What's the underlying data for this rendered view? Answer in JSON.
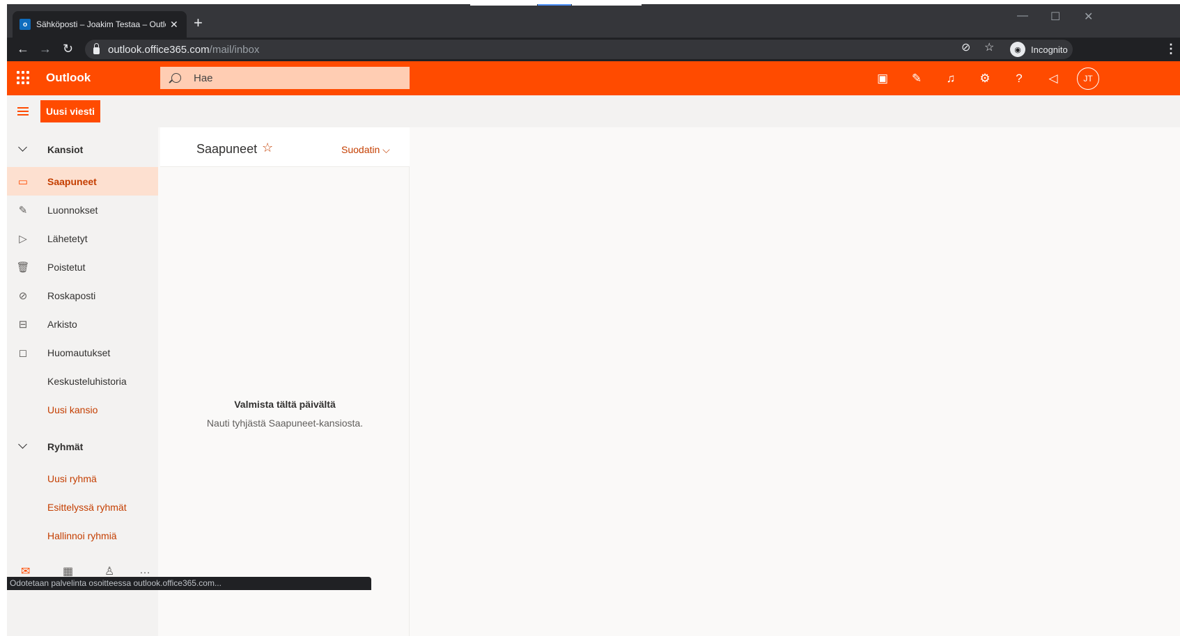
{
  "browser": {
    "tab_title": "Sähköposti – Joakim Testaa – Outlook",
    "tab_favicon": "o",
    "url_host": "outlook.office365.com",
    "url_path": "/mail/inbox",
    "incognito_label": "Incognito",
    "status_text": "Odotetaan palvelinta osoitteessa outlook.office365.com..."
  },
  "header": {
    "app_name": "Outlook",
    "search_placeholder": "Hae",
    "avatar_initials": "JT",
    "brand_color": "#ff4b00",
    "icons": [
      "office-icon",
      "todo-icon",
      "bell-icon",
      "gear-icon",
      "help-icon",
      "megaphone-icon"
    ]
  },
  "toolbar": {
    "new_message_label": "Uusi viesti"
  },
  "nav": {
    "folders_label": "Kansiot",
    "items": [
      {
        "label": "Saapuneet",
        "icon": "inbox-icon",
        "active": true
      },
      {
        "label": "Luonnokset",
        "icon": "pencil-icon"
      },
      {
        "label": "Lähetetyt",
        "icon": "send-icon"
      },
      {
        "label": "Poistetut",
        "icon": "trash-icon"
      },
      {
        "label": "Roskaposti",
        "icon": "blocked-icon"
      },
      {
        "label": "Arkisto",
        "icon": "archive-icon"
      },
      {
        "label": "Huomautukset",
        "icon": "note-icon"
      },
      {
        "label": "Keskusteluhistoria"
      }
    ],
    "new_folder_label": "Uusi kansio",
    "groups_label": "Ryhmät",
    "group_links": [
      {
        "label": "Uusi ryhmä"
      },
      {
        "label": "Esittelyssä ryhmät"
      },
      {
        "label": "Hallinnoi ryhmiä"
      }
    ]
  },
  "message_list": {
    "folder_title": "Saapuneet",
    "filter_label": "Suodatin",
    "empty_title": "Valmista tältä päivältä",
    "empty_subtitle": "Nauti tyhjästä Saapuneet-kansiosta."
  }
}
